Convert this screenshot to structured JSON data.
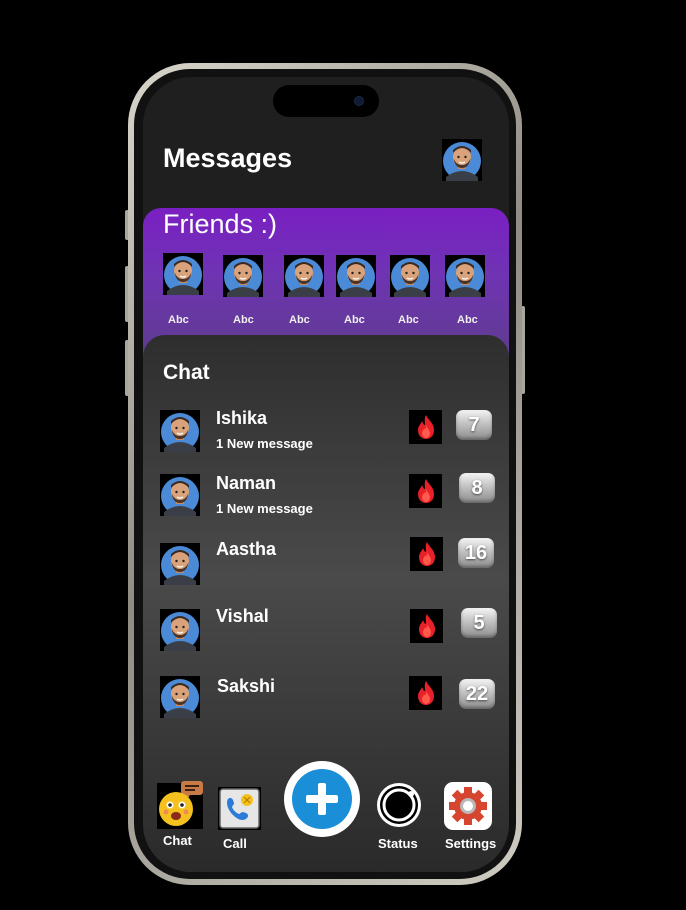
{
  "header": {
    "title": "Messages"
  },
  "friends": {
    "title": "Friends :)",
    "items": [
      {
        "name": "Abc"
      },
      {
        "name": "Abc"
      },
      {
        "name": "Abc"
      },
      {
        "name": "Abc"
      },
      {
        "name": "Abc"
      },
      {
        "name": "Abc"
      }
    ]
  },
  "chat": {
    "title": "Chat",
    "contacts": [
      {
        "name": "Ishika",
        "subtitle": "1 New message",
        "count": "7"
      },
      {
        "name": "Naman",
        "subtitle": "1 New message",
        "count": "8"
      },
      {
        "name": "Aastha",
        "subtitle": "",
        "count": "16"
      },
      {
        "name": "Vishal",
        "subtitle": "",
        "count": "5"
      },
      {
        "name": "Sakshi",
        "subtitle": "",
        "count": "22"
      }
    ]
  },
  "nav": {
    "chat_label": "Chat",
    "call_label": "Call",
    "status_label": "Status",
    "settings_label": "Settings"
  },
  "colors": {
    "friends_panel": "#7a1fc2",
    "fab": "#1a8fd8",
    "fire": "#e8202a"
  }
}
